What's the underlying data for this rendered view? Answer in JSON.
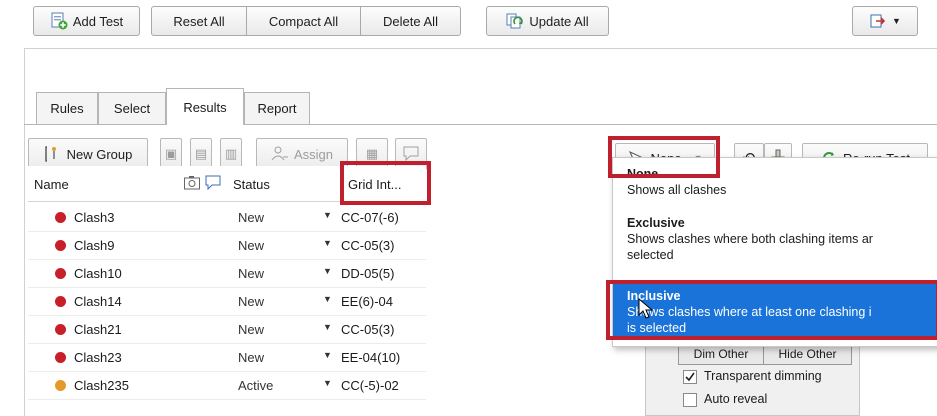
{
  "toolbar": {
    "add_test": "Add Test",
    "reset_all": "Reset All",
    "compact_all": "Compact All",
    "delete_all": "Delete All",
    "update_all": "Update All"
  },
  "tabs": [
    {
      "label": "Rules"
    },
    {
      "label": "Select"
    },
    {
      "label": "Results"
    },
    {
      "label": "Report"
    }
  ],
  "results_toolbar": {
    "new_group": "New Group",
    "assign": "Assign",
    "filter_value": "None",
    "rerun": "Re-run Test"
  },
  "grid": {
    "col_name": "Name",
    "col_status": "Status",
    "col_grid": "Grid Int...",
    "rows": [
      {
        "name": "Clash3",
        "status": "New",
        "grid": "CC-07(-6)",
        "color": "#c8202a"
      },
      {
        "name": "Clash9",
        "status": "New",
        "grid": "CC-05(3)",
        "color": "#c8202a"
      },
      {
        "name": "Clash10",
        "status": "New",
        "grid": "DD-05(5)",
        "color": "#c8202a"
      },
      {
        "name": "Clash14",
        "status": "New",
        "grid": "EE(6)-04",
        "color": "#c8202a"
      },
      {
        "name": "Clash21",
        "status": "New",
        "grid": "CC-05(3)",
        "color": "#c8202a"
      },
      {
        "name": "Clash23",
        "status": "New",
        "grid": "EE-04(10)",
        "color": "#c8202a"
      },
      {
        "name": "Clash235",
        "status": "Active",
        "grid": "CC(-5)-02",
        "color": "#e39a2b"
      }
    ]
  },
  "filter_menu": {
    "items": [
      {
        "title": "None",
        "desc": "Shows all clashes"
      },
      {
        "title": "Exclusive",
        "desc": "Shows clashes where both clashing items ar",
        "desc2": "selected"
      },
      {
        "title": "Inclusive",
        "desc": "Shows clashes where at least one clashing i",
        "desc2": "is selected"
      }
    ]
  },
  "panel": {
    "btn_left": "Dim Other",
    "btn_right": "Hide Other",
    "chk1": "Transparent dimming",
    "chk2": "Auto reveal"
  },
  "colors": {
    "highlight_red": "#c0202e",
    "menu_selected": "#1a73d9",
    "status_new": "#c8202a",
    "status_active": "#e39a2b"
  }
}
